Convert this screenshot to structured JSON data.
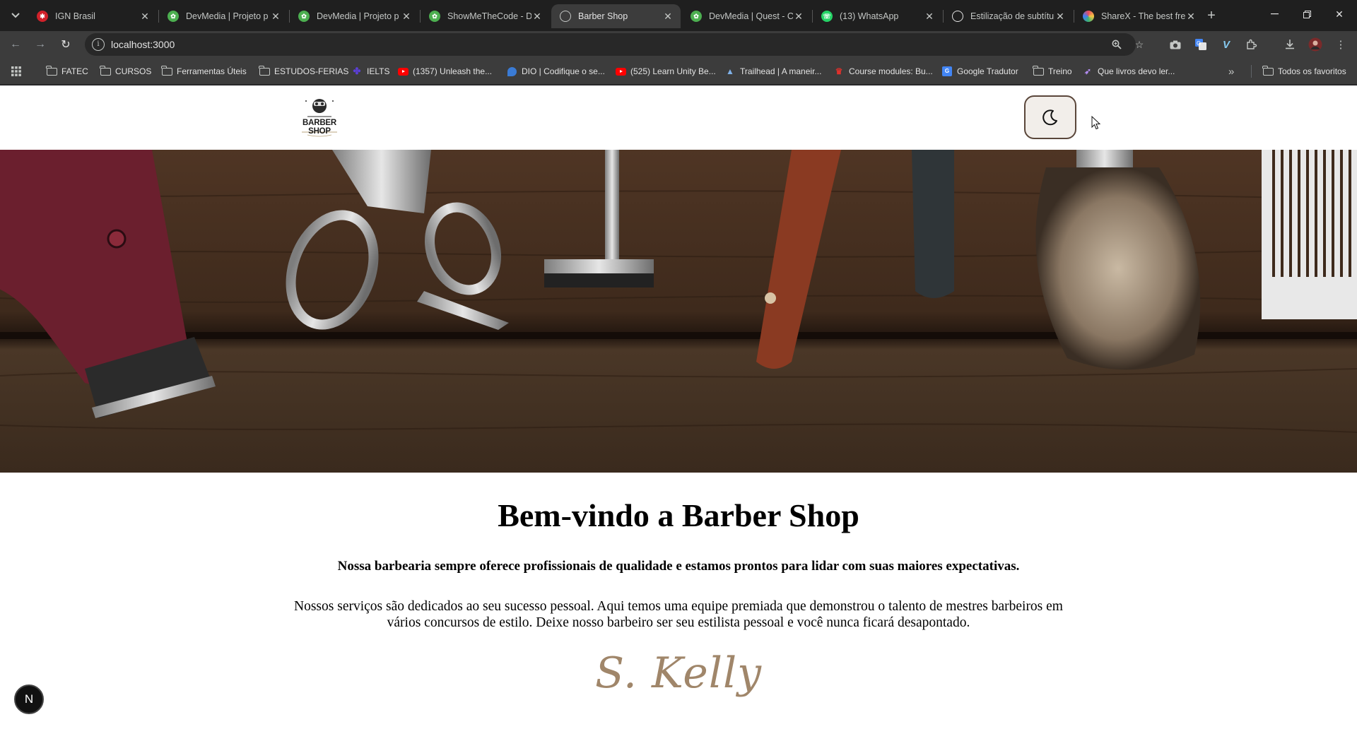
{
  "browser": {
    "tabs": [
      {
        "title": "IGN Brasil",
        "favicon": "ign-icon",
        "color": "#d0212a"
      },
      {
        "title": "DevMedia | Projeto p",
        "favicon": "devmedia-icon",
        "color": "#4caf50"
      },
      {
        "title": "DevMedia | Projeto p",
        "favicon": "devmedia-icon",
        "color": "#4caf50"
      },
      {
        "title": "ShowMeTheCode - D",
        "favicon": "devmedia-icon",
        "color": "#4caf50"
      },
      {
        "title": "Barber Shop",
        "favicon": "globe-icon",
        "color": "#9aa0a6",
        "active": true
      },
      {
        "title": "DevMedia | Quest - C",
        "favicon": "devmedia-icon",
        "color": "#4caf50"
      },
      {
        "title": "(13) WhatsApp",
        "favicon": "whatsapp-icon",
        "color": "#25d366"
      },
      {
        "title": "Estilização de subtítul",
        "favicon": "openai-icon",
        "color": "#e3e3e3"
      },
      {
        "title": "ShareX - The best fre",
        "favicon": "sharex-icon",
        "color": "#e84a5f"
      }
    ],
    "url": "localhost:3000"
  },
  "bookmarks": [
    {
      "label": "FATEC",
      "icon": "folder-icon"
    },
    {
      "label": "CURSOS",
      "icon": "folder-icon"
    },
    {
      "label": "Ferramentas Úteis",
      "icon": "folder-icon"
    },
    {
      "label": "ESTUDOS-FERIAS",
      "icon": "folder-icon"
    },
    {
      "label": "IELTS",
      "icon": "ielts-icon"
    },
    {
      "label": "(1357) Unleash the...",
      "icon": "youtube-icon"
    },
    {
      "label": "DIO | Codifique o se...",
      "icon": "dio-icon"
    },
    {
      "label": "(525) Learn Unity Be...",
      "icon": "youtube-icon"
    },
    {
      "label": "Trailhead | A maneir...",
      "icon": "trailhead-icon"
    },
    {
      "label": "Course modules: Bu...",
      "icon": "course-icon"
    },
    {
      "label": "Google Tradutor",
      "icon": "translate-icon"
    },
    {
      "label": "Treino",
      "icon": "folder-icon"
    },
    {
      "label": "Que livros devo ler...",
      "icon": "rocket-icon"
    },
    {
      "label": "Todos os favoritos",
      "icon": "folder-icon"
    }
  ],
  "site": {
    "logo_text": "BARBER SHOP",
    "welcome_title": "Bem-vindo a Barber Shop",
    "lead": "Nossa barbearia sempre oferece profissionais de qualidade e estamos prontos para lidar com suas maiores expectativas.",
    "description": "Nossos serviços são dedicados ao seu sucesso pessoal. Aqui temos uma equipe premiada que demonstrou o talento de mestres barbeiros em vários concursos de estilo. Deixe nosso barbeiro ser seu estilista pessoal e você nunca ficará desapontado.",
    "signature": "S. Kelly",
    "dev_badge": "N"
  },
  "colors": {
    "accent": "#a0866a",
    "theme_button_border": "#5a463a",
    "theme_button_bg": "#f2eeea"
  }
}
